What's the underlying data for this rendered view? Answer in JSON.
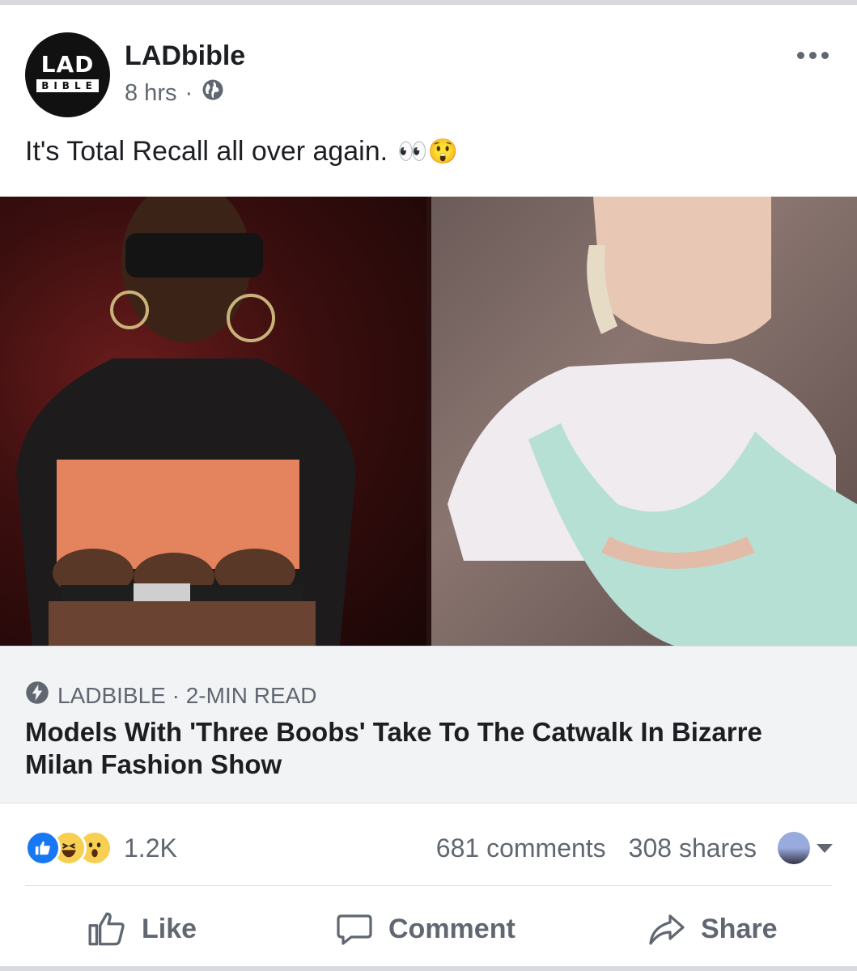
{
  "post": {
    "page_name": "LADbible",
    "logo_line1": "LAD",
    "logo_line2": "BIBLE",
    "time": "8 hrs",
    "separator": "·",
    "privacy_icon": "globe-icon",
    "caption": "It's Total Recall all over again.",
    "caption_emoji": "👀😲"
  },
  "link": {
    "source": "LADBIBLE · 2-MIN READ",
    "headline": "Models With 'Three Boobs' Take To The Catwalk In Bizarre Milan Fashion Show"
  },
  "engagement": {
    "reactions": [
      "like",
      "haha",
      "wow"
    ],
    "reaction_count": "1.2K",
    "comments": "681 comments",
    "shares": "308 shares"
  },
  "actions": {
    "like": "Like",
    "comment": "Comment",
    "share": "Share"
  },
  "colors": {
    "accent": "#1877f2",
    "muted_text": "#606770",
    "link_bg": "#f2f3f5"
  }
}
